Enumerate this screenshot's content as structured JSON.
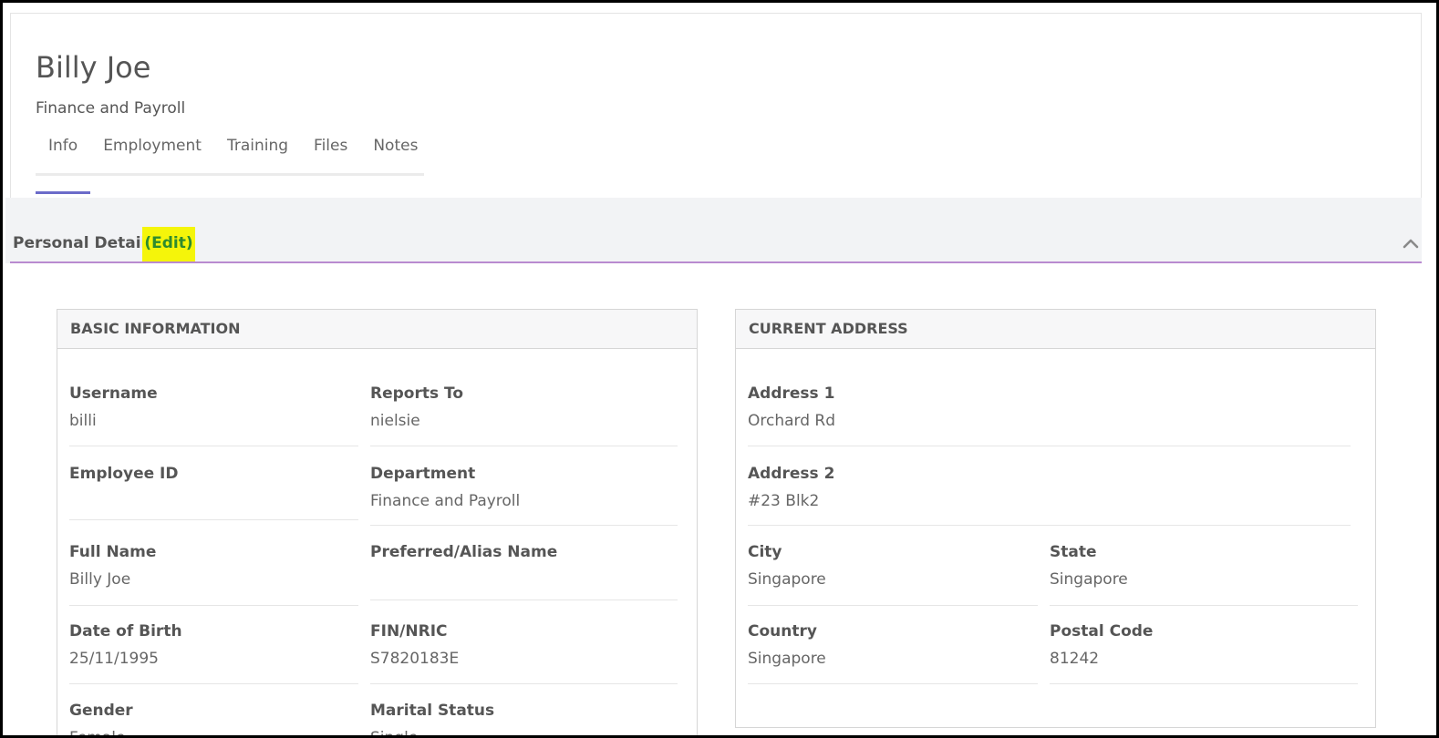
{
  "employee": {
    "name": "Billy Joe",
    "department": "Finance and Payroll"
  },
  "tabs": [
    {
      "label": "Info",
      "active": true
    },
    {
      "label": "Employment",
      "active": false
    },
    {
      "label": "Training",
      "active": false
    },
    {
      "label": "Files",
      "active": false
    },
    {
      "label": "Notes",
      "active": false
    }
  ],
  "section": {
    "title": "Personal Details",
    "edit_label": "(Edit)",
    "collapse_icon": "chevron-up-icon"
  },
  "basic_info": {
    "heading": "BASIC INFORMATION",
    "fields": [
      {
        "label": "Username",
        "value": "billi"
      },
      {
        "label": "Reports To",
        "value": "nielsie"
      },
      {
        "label": "Employee ID",
        "value": ""
      },
      {
        "label": "Department",
        "value": "Finance and Payroll"
      },
      {
        "label": "Full Name",
        "value": "Billy Joe"
      },
      {
        "label": "Preferred/Alias Name",
        "value": ""
      },
      {
        "label": "Date of Birth",
        "value": "25/11/1995"
      },
      {
        "label": "FIN/NRIC",
        "value": "S7820183E"
      },
      {
        "label": "Gender",
        "value": "Female"
      },
      {
        "label": "Marital Status",
        "value": "Single"
      }
    ]
  },
  "current_address": {
    "heading": "CURRENT ADDRESS",
    "fields": [
      {
        "label": "Address 1",
        "value": "Orchard Rd"
      },
      {
        "label": "Address 2",
        "value": "#23 Blk2"
      },
      {
        "label": "City",
        "value": "Singapore"
      },
      {
        "label": "State",
        "value": "Singapore"
      },
      {
        "label": "Country",
        "value": "Singapore"
      },
      {
        "label": "Postal Code",
        "value": "81242"
      }
    ]
  },
  "colors": {
    "active_tab": "#6b6bc9",
    "section_underline": "#b98ad0",
    "edit_highlight": "#f5f50a",
    "edit_text": "#2e8b2e"
  }
}
